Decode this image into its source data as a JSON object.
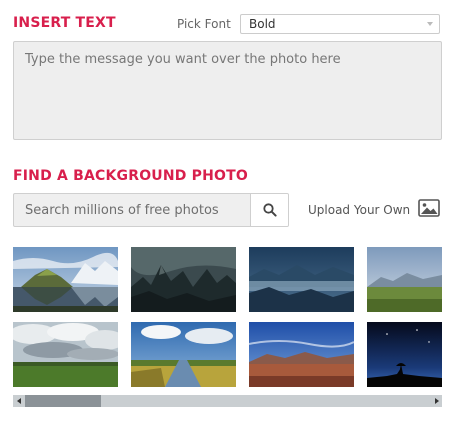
{
  "insert_text": {
    "title": "INSERT TEXT",
    "font_label": "Pick Font",
    "font_selected": "Bold",
    "message_placeholder": "Type the message you want over the photo here"
  },
  "background": {
    "title": "FIND A BACKGROUND PHOTO",
    "search_placeholder": "Search millions of free photos",
    "search_icon": "magnifier-icon",
    "upload_label": "Upload Your Own",
    "upload_icon": "image-icon"
  },
  "photos": [
    {
      "subject": "mountain lake reflection"
    },
    {
      "subject": "dark misty mountain peaks"
    },
    {
      "subject": "blue hazy mountain valley"
    },
    {
      "subject": "green grassland with mountains"
    },
    {
      "subject": "cloudy sky over green field"
    },
    {
      "subject": "river canal through fields"
    },
    {
      "subject": "red desert plain under blue sky"
    },
    {
      "subject": "night sky silhouette"
    }
  ],
  "colors": {
    "accent": "#d81f4c",
    "input_background": "#eeeeee",
    "scrollbar_track": "#c9ced1",
    "scrollbar_thumb": "#8b9297"
  }
}
